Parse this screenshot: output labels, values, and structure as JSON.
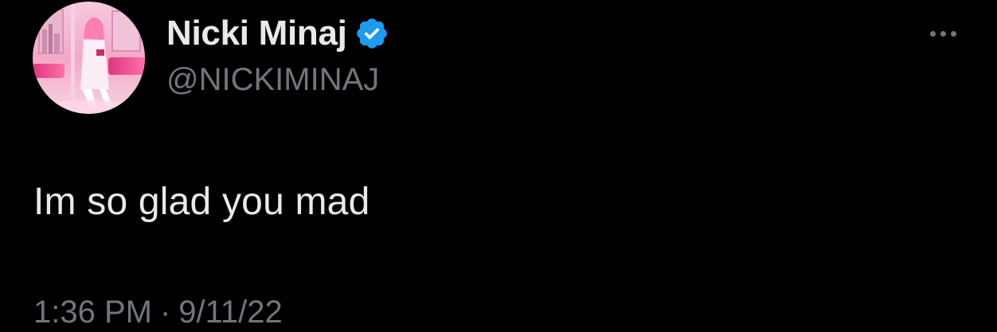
{
  "tweet": {
    "author": {
      "display_name": "Nicki Minaj",
      "handle": "@NICKIMINAJ",
      "verified": true,
      "verified_icon": "verified-badge-icon",
      "avatar_icon": "profile-avatar"
    },
    "text": "Im so glad you mad",
    "time": "1:36 PM",
    "separator": "·",
    "date": "9/11/22",
    "more_icon": "more-options-icon"
  },
  "colors": {
    "background": "#000000",
    "primary_text": "#e7e9ea",
    "secondary_text": "#71767b",
    "verified_blue": "#1d9bf0"
  }
}
